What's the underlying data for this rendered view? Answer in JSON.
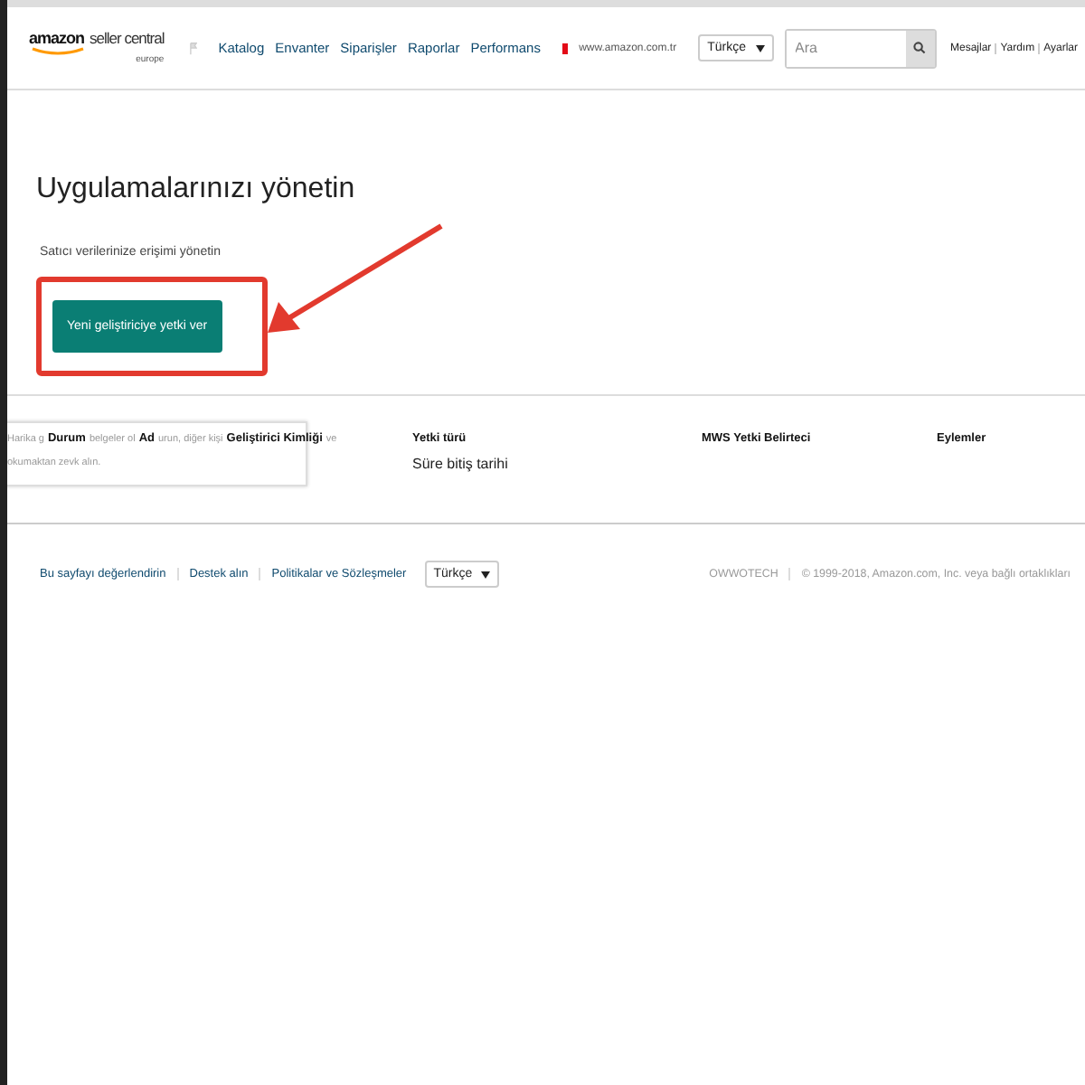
{
  "header": {
    "logo": {
      "brand": "amazon",
      "product": "seller central",
      "region": "europe"
    },
    "nav": [
      "Katalog",
      "Envanter",
      "Siparişler",
      "Raporlar",
      "Performans"
    ],
    "marketplace": "www.amazon.com.tr",
    "language": "Türkçe",
    "search": {
      "placeholder": "Ara"
    },
    "links": [
      "Mesajlar",
      "Yardım",
      "Ayarlar"
    ]
  },
  "page": {
    "title": "Uygulamalarınızı yönetin",
    "subtitle": "Satıcı verilerinize erişimi yönetin",
    "button": "Yeni geliştiriciye yetki ver"
  },
  "tooltip": {
    "line1": [
      "Harika g",
      "belgeler ol",
      "urun, diğer kişi",
      "ve"
    ],
    "line2": "okumaktan zevk alın."
  },
  "table": {
    "columns": [
      {
        "label": "Durum"
      },
      {
        "label": "Ad"
      },
      {
        "label": "Geliştirici Kimliği"
      },
      {
        "label": "Yetki türü",
        "sub": "Süre bitiş tarihi"
      },
      {
        "label": "MWS Yetki Belirteci"
      },
      {
        "label": "Eylemler"
      }
    ]
  },
  "footer": {
    "links": [
      "Bu sayfayı değerlendirin",
      "Destek alın",
      "Politikalar ve Sözleşmeler"
    ],
    "language": "Türkçe",
    "company": "OWWOTECH",
    "copyright": "© 1999-2018, Amazon.com, Inc. veya bağlı ortaklıkları"
  }
}
